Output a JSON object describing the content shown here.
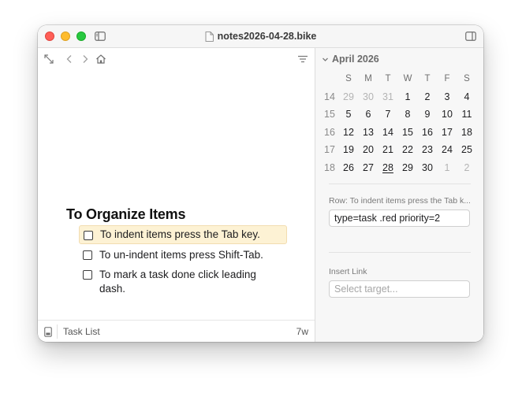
{
  "window": {
    "title": "notes2026-04-28.bike"
  },
  "icons": {
    "close": "traffic-light-close",
    "minimize": "traffic-light-minimize",
    "maximize": "traffic-light-maximize",
    "sidebar": "sidebar-icon",
    "document": "document-icon",
    "inspector": "inspector-icon",
    "expand": "expand-arrows-icon",
    "back": "chevron-left-icon",
    "forward": "chevron-right-icon",
    "home": "home-icon",
    "filter": "filter-lines-icon",
    "status": "phone-icon"
  },
  "colors": {
    "close": "#ff5f57",
    "minimize": "#febc2e",
    "maximize": "#28c840",
    "selection": "#fdf2d4"
  },
  "outline": {
    "heading": "To Organize Items",
    "rows": [
      {
        "text": "To indent items press the Tab key.",
        "selected": true
      },
      {
        "text": "To un-indent items press Shift-Tab.",
        "selected": false
      },
      {
        "text_lines": [
          "To mark a task done click leading",
          "dash."
        ],
        "selected": false
      }
    ]
  },
  "statusbar": {
    "mode": "Task List",
    "count": "7w"
  },
  "calendar": {
    "month": "April 2026",
    "weekday_headers": [
      "S",
      "M",
      "T",
      "W",
      "T",
      "F",
      "S"
    ],
    "weeks": [
      {
        "week": "14",
        "days": [
          "29",
          "30",
          "31",
          "1",
          "2",
          "3",
          "4"
        ],
        "outside": [
          0,
          1,
          2
        ]
      },
      {
        "week": "15",
        "days": [
          "5",
          "6",
          "7",
          "8",
          "9",
          "10",
          "11"
        ],
        "outside": []
      },
      {
        "week": "16",
        "days": [
          "12",
          "13",
          "14",
          "15",
          "16",
          "17",
          "18"
        ],
        "outside": []
      },
      {
        "week": "17",
        "days": [
          "19",
          "20",
          "21",
          "22",
          "23",
          "24",
          "25"
        ],
        "outside": []
      },
      {
        "week": "18",
        "days": [
          "26",
          "27",
          "28",
          "29",
          "30",
          "1",
          "2"
        ],
        "outside": [
          5,
          6
        ],
        "today": 2
      }
    ]
  },
  "inspector": {
    "row_label": "Row: To indent items press the Tab k...",
    "row_value": "type=task .red priority=2",
    "link_label": "Insert Link",
    "link_placeholder": "Select target..."
  }
}
